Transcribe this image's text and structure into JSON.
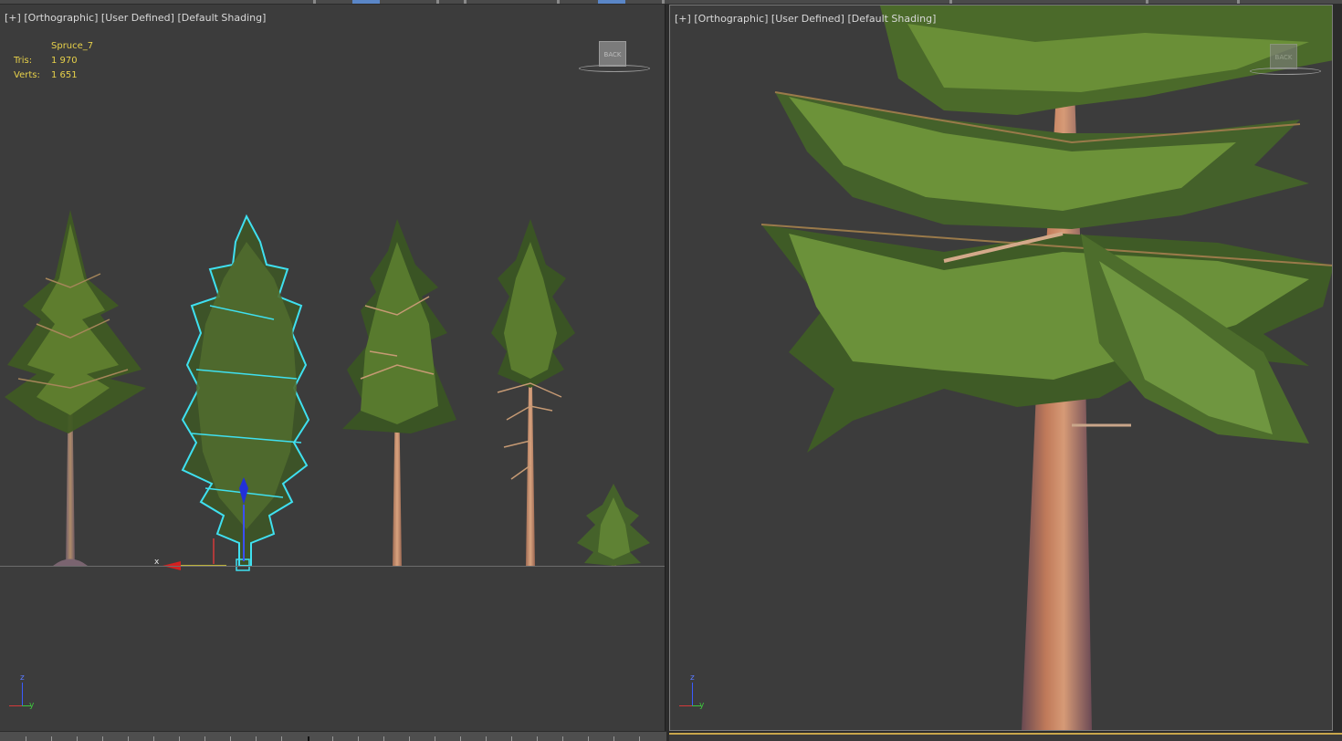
{
  "left_viewport": {
    "label_parts": [
      "[+]",
      "[Orthographic]",
      "[User Defined]",
      "[Default Shading]"
    ],
    "object_name": "Spruce_7",
    "stats": [
      {
        "label": "Tris:",
        "value": "1 970"
      },
      {
        "label": "Verts:",
        "value": "1 651"
      }
    ],
    "viewcube_label": "BACK",
    "axis_labels": {
      "z": "z",
      "y": "y",
      "x": "x"
    }
  },
  "right_viewport": {
    "label_parts": [
      "[+]",
      "[Orthographic]",
      "[User Defined]",
      "[Default Shading]"
    ],
    "viewcube_label": "BACK",
    "axis_labels": {
      "z": "z",
      "y": "y"
    }
  },
  "colors": {
    "viewport_bg": "#3c3c3c",
    "selection_outline": "#3fe0f0",
    "stats_text": "#e7d14a",
    "active_border": "#c9a64b"
  }
}
